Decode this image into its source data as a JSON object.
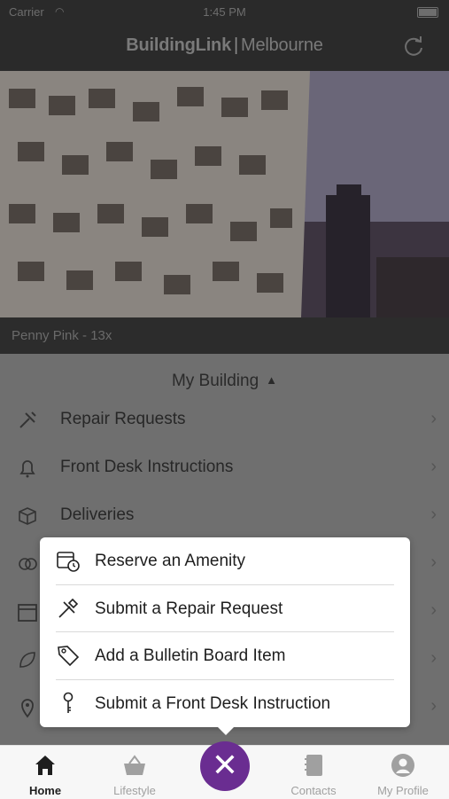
{
  "status_bar": {
    "carrier": "Carrier",
    "time": "1:45 PM"
  },
  "header": {
    "brand_bold": "BuildingLink",
    "brand_separator": "|",
    "brand_city": "Melbourne",
    "refresh_icon": "refresh-icon"
  },
  "hero": {
    "caption": "Penny Pink - 13x"
  },
  "section": {
    "title": "My Building",
    "caret": "▲",
    "items": [
      {
        "label": "Repair Requests",
        "icon": "tools-icon"
      },
      {
        "label": "Front Desk Instructions",
        "icon": "bell-icon"
      },
      {
        "label": "Deliveries",
        "icon": "package-icon"
      }
    ]
  },
  "popup": {
    "items": [
      {
        "label": "Reserve an Amenity",
        "icon": "calendar-clock-icon"
      },
      {
        "label": "Submit a Repair Request",
        "icon": "tools-icon"
      },
      {
        "label": "Add a Bulletin Board Item",
        "icon": "tag-icon"
      },
      {
        "label": "Submit a Front Desk Instruction",
        "icon": "key-icon"
      }
    ]
  },
  "tabs": [
    {
      "label": "Home",
      "icon": "home-icon",
      "active": true
    },
    {
      "label": "Lifestyle",
      "icon": "basket-icon",
      "active": false
    },
    {
      "label": "Contacts",
      "icon": "address-book-icon",
      "active": false
    },
    {
      "label": "My Profile",
      "icon": "profile-icon",
      "active": false
    }
  ],
  "fab": {
    "glyph": "✕",
    "icon": "close-icon"
  },
  "colors": {
    "accent": "#6a2d91",
    "header_bg": "#2a2a2a",
    "dim_overlay": "#6f6f6f"
  }
}
